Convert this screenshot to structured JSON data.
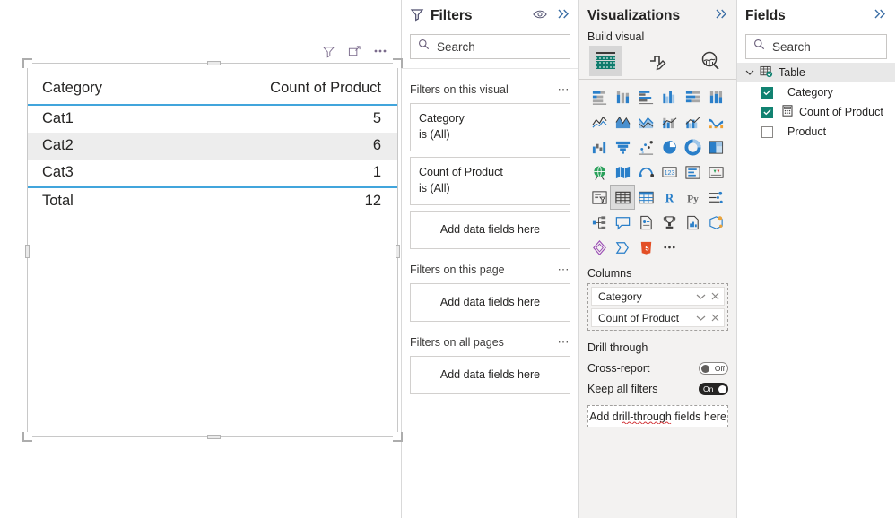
{
  "canvas": {
    "visual_toolbar": [
      {
        "name": "filter-icon",
        "title": "Filters"
      },
      {
        "name": "focus-mode-icon",
        "title": "Focus mode"
      },
      {
        "name": "more-options-icon",
        "title": "More options"
      }
    ],
    "table_visual": {
      "columns": [
        "Category",
        "Count of Product"
      ],
      "rows": [
        {
          "category": "Cat1",
          "count": "5"
        },
        {
          "category": "Cat2",
          "count": "6"
        },
        {
          "category": "Cat3",
          "count": "1"
        }
      ],
      "total_label": "Total",
      "total_value": "12",
      "header_rule_color": "#41a5dc",
      "alt_row_color": "#ededed"
    }
  },
  "filters": {
    "title": "Filters",
    "actions": {
      "eye": "hide-filter-pane",
      "collapse": "collapse-pane"
    },
    "search": {
      "placeholder": "Search",
      "value": ""
    },
    "sections": [
      {
        "label": "Filters on this visual",
        "cards": [
          {
            "name": "Category",
            "condition": "is (All)"
          },
          {
            "name": "Count of Product",
            "condition": "is (All)"
          }
        ],
        "dropzone": "Add data fields here"
      },
      {
        "label": "Filters on this page",
        "cards": [],
        "dropzone": "Add data fields here"
      },
      {
        "label": "Filters on all pages",
        "cards": [],
        "dropzone": "Add data fields here"
      }
    ]
  },
  "visualizations": {
    "title": "Visualizations",
    "build_label": "Build visual",
    "tabs": [
      {
        "name": "build-visual-tab",
        "selected": true
      },
      {
        "name": "format-visual-tab",
        "selected": false
      },
      {
        "name": "analytics-tab",
        "selected": false
      }
    ],
    "icons": [
      "stacked-bar-chart",
      "stacked-column-chart",
      "clustered-bar-chart",
      "clustered-column-chart",
      "100-stacked-bar-chart",
      "100-stacked-column-chart",
      "line-chart",
      "area-chart",
      "stacked-area-chart",
      "line-stacked-column-chart",
      "line-clustered-column-chart",
      "ribbon-chart",
      "waterfall-chart",
      "funnel-chart",
      "scatter-chart",
      "pie-chart",
      "donut-chart",
      "treemap",
      "map",
      "filled-map",
      "azure-map",
      "card",
      "multi-row-card",
      "kpi",
      "slicer",
      "table",
      "matrix",
      "r-script-visual",
      "python-visual",
      "key-influencers",
      "decomposition-tree",
      "qna-visual",
      "smart-narrative",
      "metrics",
      "paginated-report",
      "power-apps",
      "arcgis-maps",
      "power-automate",
      "html-visual",
      "more-visuals"
    ],
    "selected_icon": "table",
    "columns_label": "Columns",
    "columns": [
      {
        "label": "Category"
      },
      {
        "label": "Count of Product"
      }
    ],
    "drill_through": {
      "label": "Drill through",
      "cross_report": {
        "label": "Cross-report",
        "state": "Off",
        "on": false
      },
      "keep_all_filters": {
        "label": "Keep all filters",
        "state": "On",
        "on": true
      },
      "dropzone": "Add drill-through fields here"
    }
  },
  "fields": {
    "title": "Fields",
    "search": {
      "placeholder": "Search",
      "value": ""
    },
    "table": {
      "label": "Table",
      "expanded": true,
      "items": [
        {
          "label": "Category",
          "checked": true,
          "kind": "column"
        },
        {
          "label": "Count of Product",
          "checked": true,
          "kind": "measure"
        },
        {
          "label": "Product",
          "checked": false,
          "kind": "column"
        }
      ]
    }
  },
  "colors": {
    "accent": "#41a5dc",
    "teal": "#118271",
    "pane_bg": "#f3f2f1"
  }
}
